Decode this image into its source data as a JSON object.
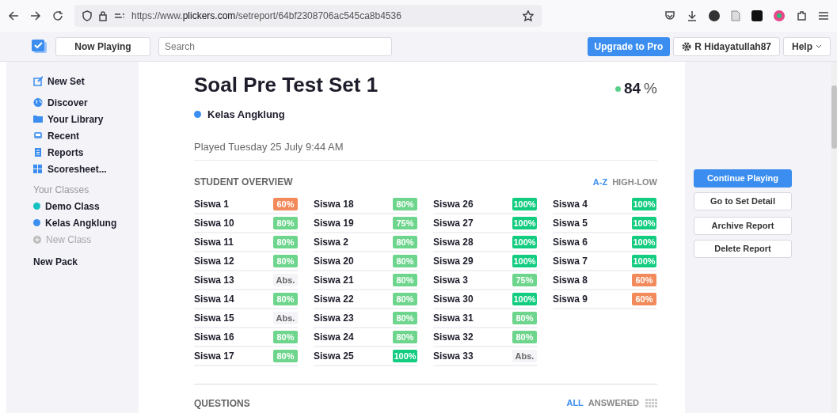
{
  "browser": {
    "url_host": "https://www.",
    "url_domain": "plickers.com",
    "url_path": "/setreport/64bf2308706ac545ca8b4536"
  },
  "topbar": {
    "now_playing": "Now Playing",
    "search": {
      "placeholder": "Search"
    },
    "upgrade": "Upgrade to Pro",
    "user": "R Hidayatullah87",
    "help": "Help"
  },
  "sidebar": {
    "items": [
      {
        "label": "New Set"
      },
      {
        "label": "Discover"
      },
      {
        "label": "Your Library"
      },
      {
        "label": "Recent"
      },
      {
        "label": "Reports"
      },
      {
        "label": "Scoresheet..."
      }
    ],
    "classes_heading": "Your Classes",
    "classes": [
      {
        "label": "Demo Class",
        "color": "#17c1c1"
      },
      {
        "label": "Kelas Angklung",
        "color": "#3b8ef0"
      }
    ],
    "new_class": "New Class",
    "new_pack": "New Pack"
  },
  "report": {
    "title": "Soal Pre Test Set 1",
    "score": "84",
    "score_unit": "%",
    "class_name": "Kelas Angklung",
    "played": "Played Tuesday 25 July 9:44 AM",
    "overview_heading": "STUDENT OVERVIEW",
    "sort": [
      {
        "label": "A-Z",
        "selected": true
      },
      {
        "label": "HIGH-LOW",
        "selected": false
      }
    ],
    "students": [
      [
        {
          "name": "Siswa 1",
          "score": "60%",
          "color": "#f28a5b"
        },
        {
          "name": "Siswa 10",
          "score": "80%",
          "color": "#6dd58c"
        },
        {
          "name": "Siswa 11",
          "score": "80%",
          "color": "#6dd58c"
        },
        {
          "name": "Siswa 12",
          "score": "80%",
          "color": "#6dd58c"
        },
        {
          "name": "Siswa 13",
          "score": "Abs.",
          "color": "#f3f3f8"
        },
        {
          "name": "Siswa 14",
          "score": "80%",
          "color": "#6dd58c"
        },
        {
          "name": "Siswa 15",
          "score": "Abs.",
          "color": "#f3f3f8"
        },
        {
          "name": "Siswa 16",
          "score": "80%",
          "color": "#6dd58c"
        },
        {
          "name": "Siswa 17",
          "score": "80%",
          "color": "#6dd58c"
        }
      ],
      [
        {
          "name": "Siswa 18",
          "score": "80%",
          "color": "#6dd58c"
        },
        {
          "name": "Siswa 19",
          "score": "75%",
          "color": "#6dd58c"
        },
        {
          "name": "Siswa 2",
          "score": "80%",
          "color": "#6dd58c"
        },
        {
          "name": "Siswa 20",
          "score": "80%",
          "color": "#6dd58c"
        },
        {
          "name": "Siswa 21",
          "score": "80%",
          "color": "#6dd58c"
        },
        {
          "name": "Siswa 22",
          "score": "80%",
          "color": "#6dd58c"
        },
        {
          "name": "Siswa 23",
          "score": "80%",
          "color": "#6dd58c"
        },
        {
          "name": "Siswa 24",
          "score": "80%",
          "color": "#6dd58c"
        },
        {
          "name": "Siswa 25",
          "score": "100%",
          "color": "#12cc80"
        }
      ],
      [
        {
          "name": "Siswa 26",
          "score": "100%",
          "color": "#12cc80"
        },
        {
          "name": "Siswa 27",
          "score": "100%",
          "color": "#12cc80"
        },
        {
          "name": "Siswa 28",
          "score": "100%",
          "color": "#12cc80"
        },
        {
          "name": "Siswa 29",
          "score": "100%",
          "color": "#12cc80"
        },
        {
          "name": "Siswa 3",
          "score": "75%",
          "color": "#6dd58c"
        },
        {
          "name": "Siswa 30",
          "score": "100%",
          "color": "#12cc80"
        },
        {
          "name": "Siswa 31",
          "score": "80%",
          "color": "#6dd58c"
        },
        {
          "name": "Siswa 32",
          "score": "80%",
          "color": "#6dd58c"
        },
        {
          "name": "Siswa 33",
          "score": "Abs.",
          "color": "#f3f3f8"
        }
      ],
      [
        {
          "name": "Siswa 4",
          "score": "100%",
          "color": "#12cc80"
        },
        {
          "name": "Siswa 5",
          "score": "100%",
          "color": "#12cc80"
        },
        {
          "name": "Siswa 6",
          "score": "100%",
          "color": "#12cc80"
        },
        {
          "name": "Siswa 7",
          "score": "100%",
          "color": "#12cc80"
        },
        {
          "name": "Siswa 8",
          "score": "60%",
          "color": "#f28a5b"
        },
        {
          "name": "Siswa 9",
          "score": "60%",
          "color": "#f28a5b"
        }
      ]
    ],
    "questions_heading": "QUESTIONS",
    "filters": [
      {
        "label": "ALL",
        "selected": true
      },
      {
        "label": "ANSWERED",
        "selected": false
      }
    ]
  },
  "actions": [
    {
      "label": "Continue Playing",
      "primary": true
    },
    {
      "label": "Go to Set Detail",
      "primary": false
    },
    {
      "label": "Archive Report",
      "primary": false
    },
    {
      "label": "Delete Report",
      "primary": false
    }
  ]
}
